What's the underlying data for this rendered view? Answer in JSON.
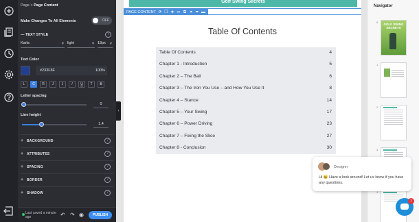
{
  "panel": {
    "breadcrumb_root": "Page",
    "breadcrumb_sep": ">",
    "breadcrumb_current": "Page Content",
    "make_changes_label": "Make Changes To All Elements",
    "toggle_label": "OFF",
    "text_style_label": "TEXT STYLE",
    "font_family": "Karla",
    "font_weight": "light",
    "font_size": "18px",
    "text_color_label": "Text Color",
    "color_hex": "#233F8F",
    "opacity": "100%",
    "format_buttons": [
      "L",
      "C",
      "R",
      "J",
      "J",
      "I",
      "U",
      "T",
      "S"
    ],
    "letter_spacing_label": "Letter spacing",
    "letter_spacing_value": "0",
    "letter_spacing_level": 0.02,
    "line_height_label": "Line height",
    "line_height_value": "1.4",
    "line_height_level": 0.3,
    "sections": [
      "BACKGROUND",
      "ATTRIBUTES",
      "SPACING",
      "BORDER",
      "SHADOW"
    ],
    "footer_saved": "Last saved a minute ago",
    "publish_label": "PUBLISH"
  },
  "canvas": {
    "header_text": "Golf Swing Secrets",
    "element_tag": "PAGE CONTENT",
    "toc_title": "Table Of Contents",
    "toc_rows": [
      {
        "title": "Table Of Contents",
        "page": "4"
      },
      {
        "title": "Chapter 1 - Introduction",
        "page": "5"
      },
      {
        "title": "Chapter 2 – The Ball",
        "page": "6"
      },
      {
        "title": "Chapter 3 – The Iron You Use – and How You Use It",
        "page": "8"
      },
      {
        "title": "Chapter 4 – Stance",
        "page": "14"
      },
      {
        "title": "Chapter 5 – Your Swing",
        "page": "17"
      },
      {
        "title": "Chapter 6 – Power Driving",
        "page": "23"
      },
      {
        "title": "Chapter 7 – Fixing the Slice",
        "page": "27"
      },
      {
        "title": "Chapter 8 - Conclusion",
        "page": "30"
      }
    ]
  },
  "navigator": {
    "title": "Navigator",
    "cover_title": "GOLF SWING SECRETS",
    "page_numbers": [
      "8",
      "1",
      "2",
      "3",
      "4"
    ]
  },
  "chat": {
    "sender": "Designrr",
    "message": "Hi 😀 Have a look around! Let us know if you have any questions.",
    "badge_count": "1"
  },
  "colors": {
    "accent": "#3d80e0",
    "teal": "#4db8a8",
    "text_color": "#233F8F"
  }
}
